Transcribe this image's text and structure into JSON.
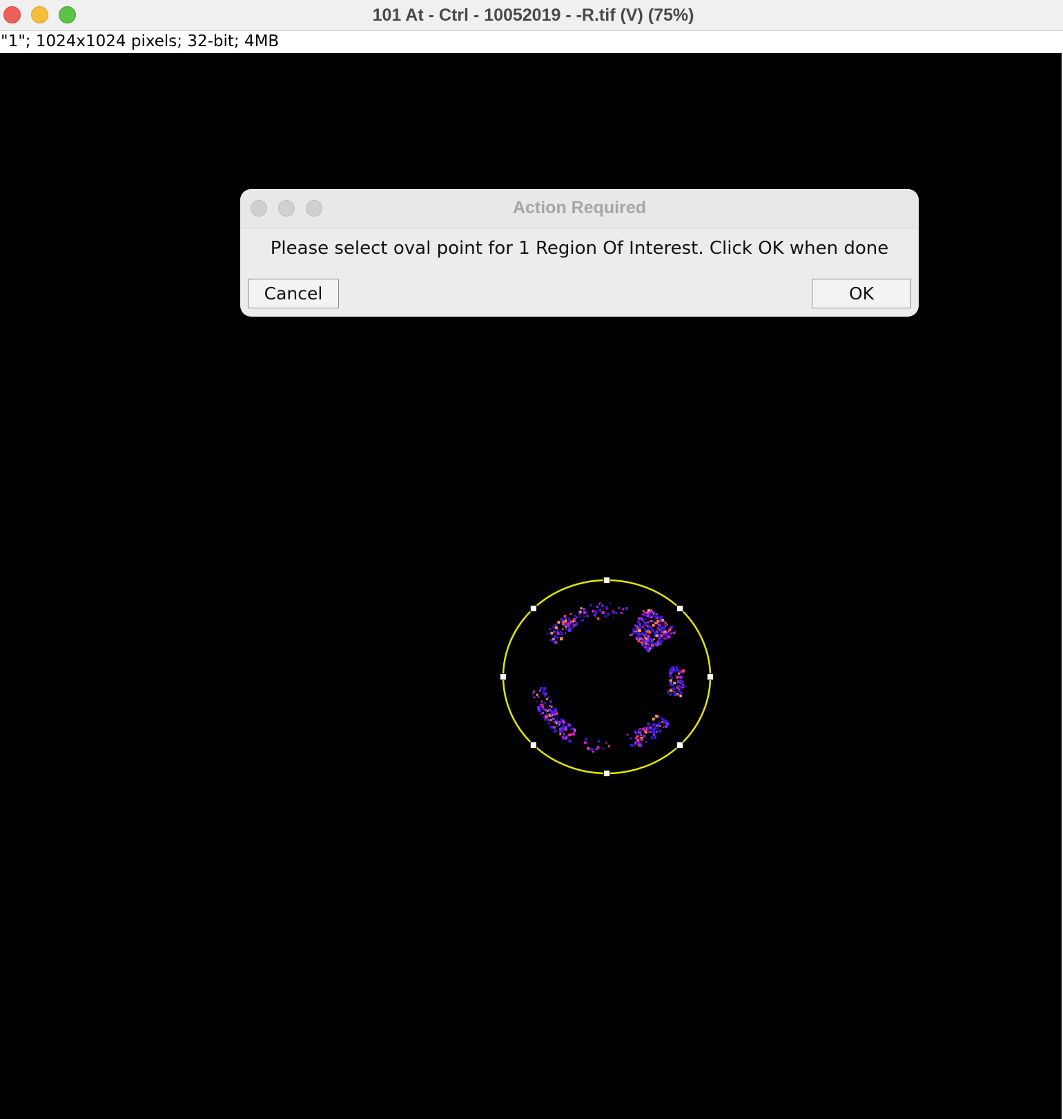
{
  "window": {
    "title": "101 At - Ctrl - 10052019 - -R.tif (V) (75%)",
    "info": "\"1\"; 1024x1024 pixels; 32-bit; 4MB",
    "controls": [
      "close-icon",
      "minimize-icon",
      "zoom-icon"
    ]
  },
  "image": {
    "background": "#000000",
    "roi": {
      "shape": "oval",
      "stroke_color": "#e6e600",
      "handle_color": "#ffffff",
      "handle_count": 8
    },
    "signal_colors": [
      "#3a1ad0",
      "#7a2bff",
      "#c21fd9",
      "#ff3c7a",
      "#ff9a3c"
    ]
  },
  "dialog": {
    "title": "Action Required",
    "message": "Please select oval point for 1 Region Of Interest. Click OK when done",
    "cancel_label": "Cancel",
    "ok_label": "OK"
  }
}
